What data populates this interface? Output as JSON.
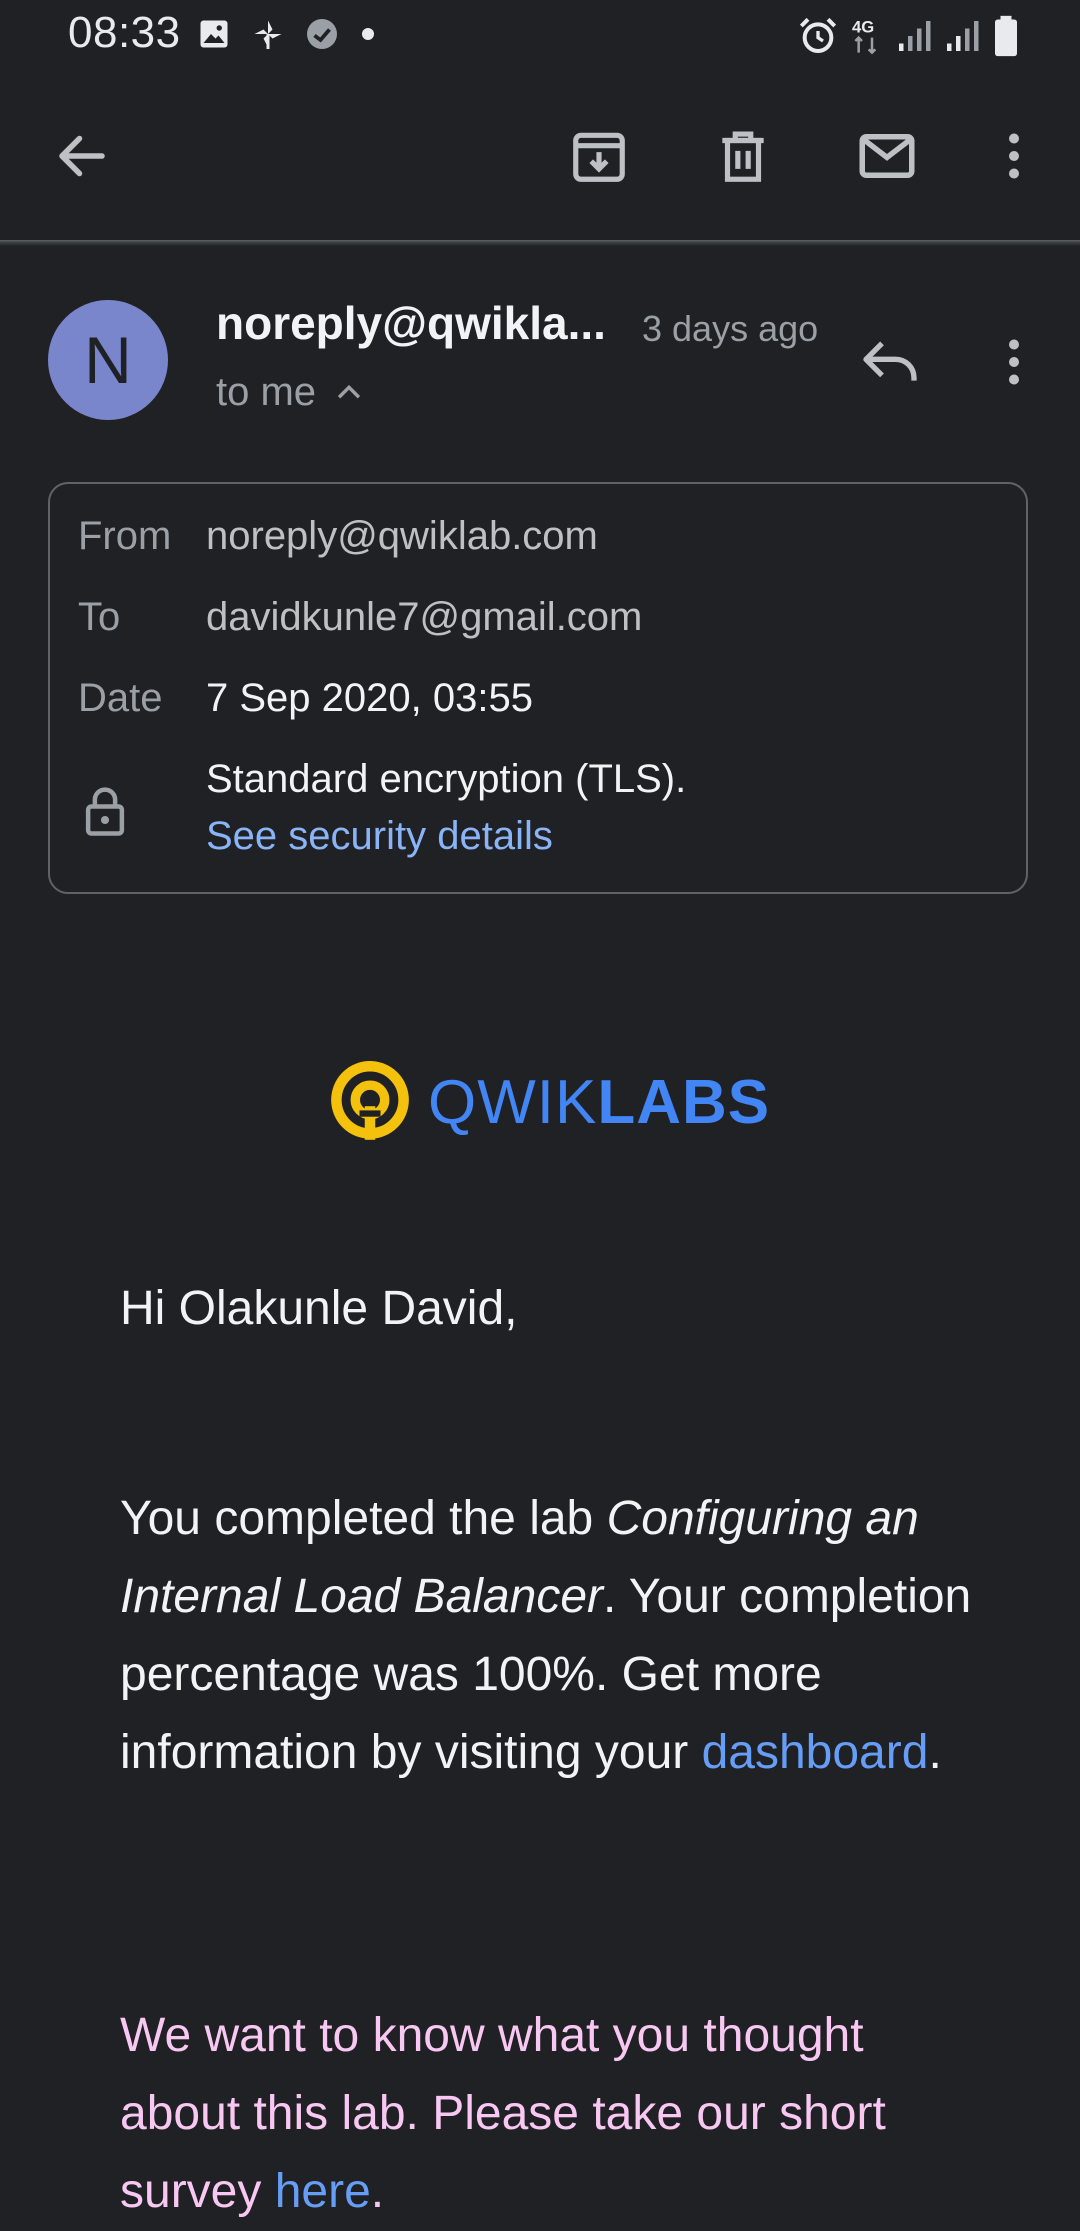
{
  "status_bar": {
    "time": "08:33",
    "left_icons": [
      "image-icon",
      "pinwheel-icon",
      "minus-circle-icon",
      "dot-icon"
    ],
    "right_icons": [
      "alarm-icon",
      "network-4g-icon",
      "signal-icon",
      "signal-icon",
      "battery-icon"
    ],
    "network_label": "4G"
  },
  "app_bar": {
    "actions": [
      "back",
      "archive",
      "delete",
      "mark-unread",
      "more"
    ]
  },
  "email_header": {
    "avatar_letter": "N",
    "sender": "noreply@qwikla...",
    "time": "3 days ago",
    "recipient_summary": "to me"
  },
  "details": {
    "from_label": "From",
    "from_value": "noreply@qwiklab.com",
    "to_label": "To",
    "to_value": "davidkunle7@gmail.com",
    "date_label": "Date",
    "date_value": "7 Sep 2020, 03:55",
    "encryption_text": "Standard encryption (TLS).",
    "security_link": "See security details"
  },
  "logo": {
    "part1": "QWIK",
    "part2": "LABS",
    "ring_color": "#f4c20d",
    "text_color": "#4285f4"
  },
  "body": {
    "greeting": "Hi Olakunle David,",
    "p1_before": "You completed the lab ",
    "p1_lab": "Configuring an Internal Load Balancer",
    "p1_after": ". Your completion percentage was 100%. Get more information by visiting your ",
    "p1_link": "dashboard",
    "p1_end": ".",
    "p2_before": "We want to know what you thought about this lab. Please take our short survey ",
    "p2_link": "here",
    "p2_end": "."
  }
}
